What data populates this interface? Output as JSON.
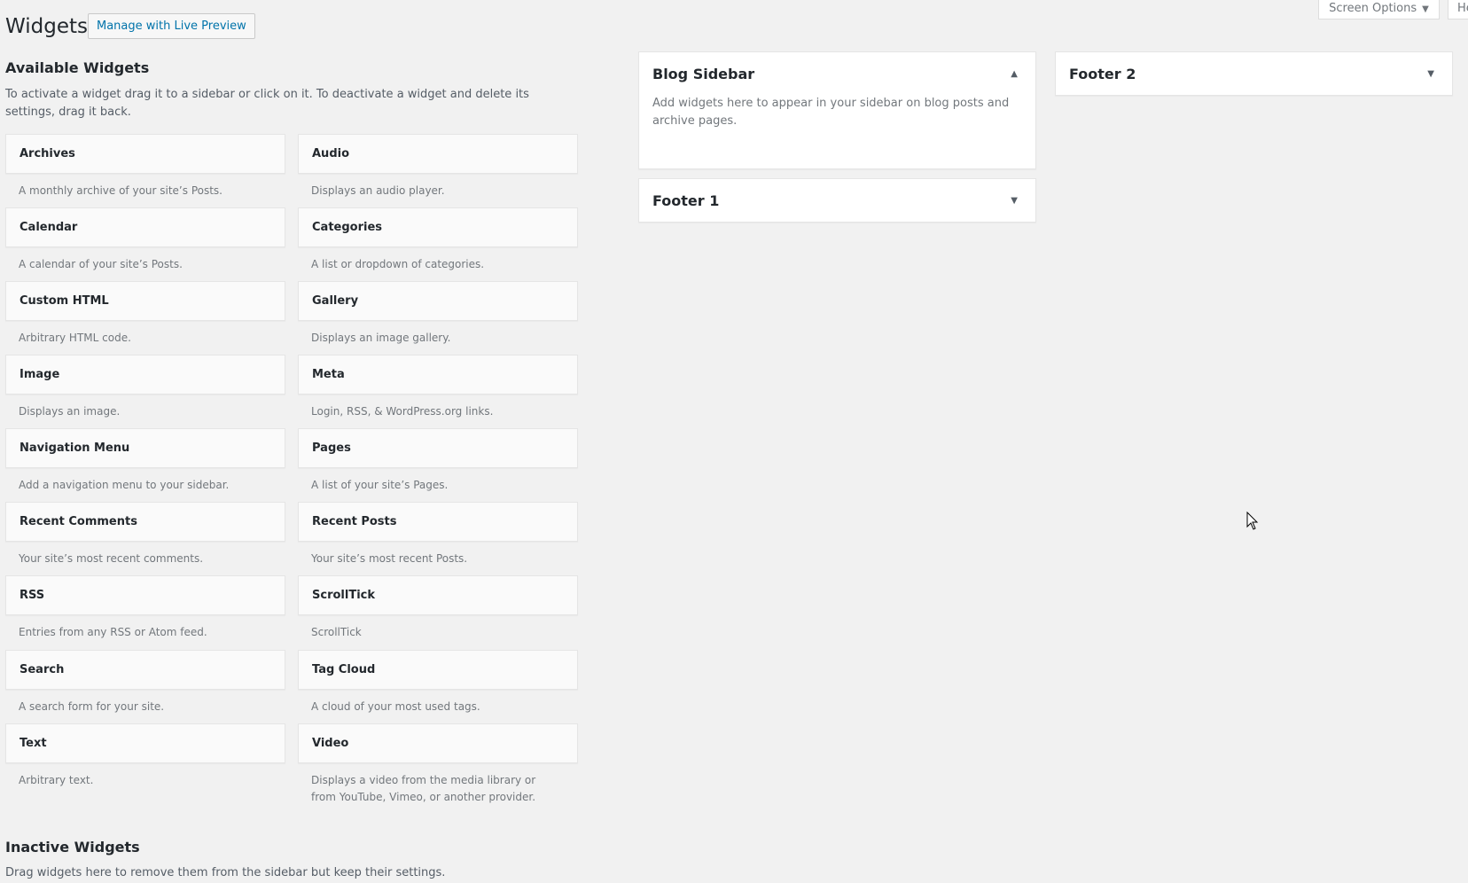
{
  "header": {
    "title": "Widgets",
    "live_preview_label": "Manage with Live Preview",
    "screen_options_label": "Screen Options",
    "help_label": "Help"
  },
  "available": {
    "title": "Available Widgets",
    "description": "To activate a widget drag it to a sidebar or click on it. To deactivate a widget and delete its settings, drag it back."
  },
  "widgets": [
    {
      "title": "Archives",
      "description": "A monthly archive of your site’s Posts."
    },
    {
      "title": "Audio",
      "description": "Displays an audio player."
    },
    {
      "title": "Calendar",
      "description": "A calendar of your site’s Posts."
    },
    {
      "title": "Categories",
      "description": "A list or dropdown of categories."
    },
    {
      "title": "Custom HTML",
      "description": "Arbitrary HTML code."
    },
    {
      "title": "Gallery",
      "description": "Displays an image gallery."
    },
    {
      "title": "Image",
      "description": "Displays an image."
    },
    {
      "title": "Meta",
      "description": "Login, RSS, & WordPress.org links."
    },
    {
      "title": "Navigation Menu",
      "description": "Add a navigation menu to your sidebar."
    },
    {
      "title": "Pages",
      "description": "A list of your site’s Pages."
    },
    {
      "title": "Recent Comments",
      "description": "Your site’s most recent comments."
    },
    {
      "title": "Recent Posts",
      "description": "Your site’s most recent Posts."
    },
    {
      "title": "RSS",
      "description": "Entries from any RSS or Atom feed."
    },
    {
      "title": "ScrollTick",
      "description": "ScrollTick"
    },
    {
      "title": "Search",
      "description": "A search form for your site."
    },
    {
      "title": "Tag Cloud",
      "description": "A cloud of your most used tags."
    },
    {
      "title": "Text",
      "description": "Arbitrary text."
    },
    {
      "title": "Video",
      "description": "Displays a video from the media library or from YouTube, Vimeo, or another provider."
    }
  ],
  "sidebars": {
    "blog_sidebar": {
      "title": "Blog Sidebar",
      "description": "Add widgets here to appear in your sidebar on blog posts and archive pages."
    },
    "footer1": {
      "title": "Footer 1"
    },
    "footer2": {
      "title": "Footer 2"
    }
  },
  "inactive": {
    "title": "Inactive Widgets",
    "description": "Drag widgets here to remove them from the sidebar but keep their settings."
  }
}
